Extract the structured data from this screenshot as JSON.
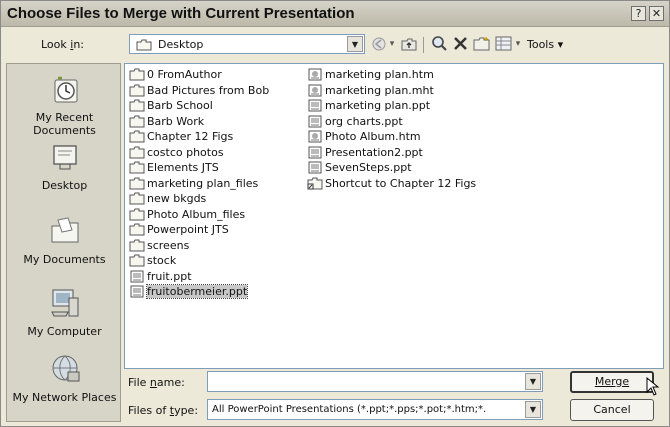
{
  "window": {
    "title": "Choose Files to Merge with Current Presentation",
    "help_glyph": "?",
    "close_glyph": "✕"
  },
  "toolbar": {
    "look_in_label": "Look in:",
    "look_in_value": "Desktop",
    "tools_label": "Tools"
  },
  "places": [
    {
      "label": "My Recent Documents",
      "icon": "recent-documents-icon"
    },
    {
      "label": "Desktop",
      "icon": "desktop-icon"
    },
    {
      "label": "My Documents",
      "icon": "my-documents-icon"
    },
    {
      "label": "My Computer",
      "icon": "my-computer-icon"
    },
    {
      "label": "My Network Places",
      "icon": "network-places-icon"
    }
  ],
  "files": {
    "column1": [
      {
        "name": "0 FromAuthor",
        "type": "folder"
      },
      {
        "name": "Bad Pictures from Bob",
        "type": "folder"
      },
      {
        "name": "Barb School",
        "type": "folder"
      },
      {
        "name": "Barb Work",
        "type": "folder"
      },
      {
        "name": "Chapter 12 Figs",
        "type": "folder"
      },
      {
        "name": "costco photos",
        "type": "folder"
      },
      {
        "name": "Elements JTS",
        "type": "folder"
      },
      {
        "name": "marketing plan_files",
        "type": "folder"
      },
      {
        "name": "new bkgds",
        "type": "folder"
      },
      {
        "name": "Photo Album_files",
        "type": "folder"
      },
      {
        "name": "Powerpoint JTS",
        "type": "folder"
      },
      {
        "name": "screens",
        "type": "folder"
      },
      {
        "name": "stock",
        "type": "folder"
      },
      {
        "name": "fruit.ppt",
        "type": "ppt"
      },
      {
        "name": "fruitobermeier.ppt",
        "type": "ppt",
        "selected": true
      }
    ],
    "column2": [
      {
        "name": "marketing plan.htm",
        "type": "htm"
      },
      {
        "name": "marketing plan.mht",
        "type": "htm"
      },
      {
        "name": "marketing plan.ppt",
        "type": "ppt"
      },
      {
        "name": "org charts.ppt",
        "type": "ppt"
      },
      {
        "name": "Photo Album.htm",
        "type": "htm"
      },
      {
        "name": "Presentation2.ppt",
        "type": "ppt"
      },
      {
        "name": "SevenSteps.ppt",
        "type": "ppt"
      },
      {
        "name": "Shortcut to Chapter 12 Figs",
        "type": "shortcut"
      }
    ]
  },
  "bottom": {
    "file_name_label": "File name:",
    "file_name_value": "",
    "files_of_type_label": "Files of type:",
    "files_of_type_value": "All PowerPoint Presentations (*.ppt;*.pps;*.pot;*.htm;*.",
    "merge_label": "Merge",
    "cancel_label": "Cancel"
  },
  "colors": {
    "dialog_bg": "#ece9d8",
    "places_bg": "#d7d4c8",
    "folder": "#f5f5ee",
    "selection": "#c8c8c8"
  }
}
